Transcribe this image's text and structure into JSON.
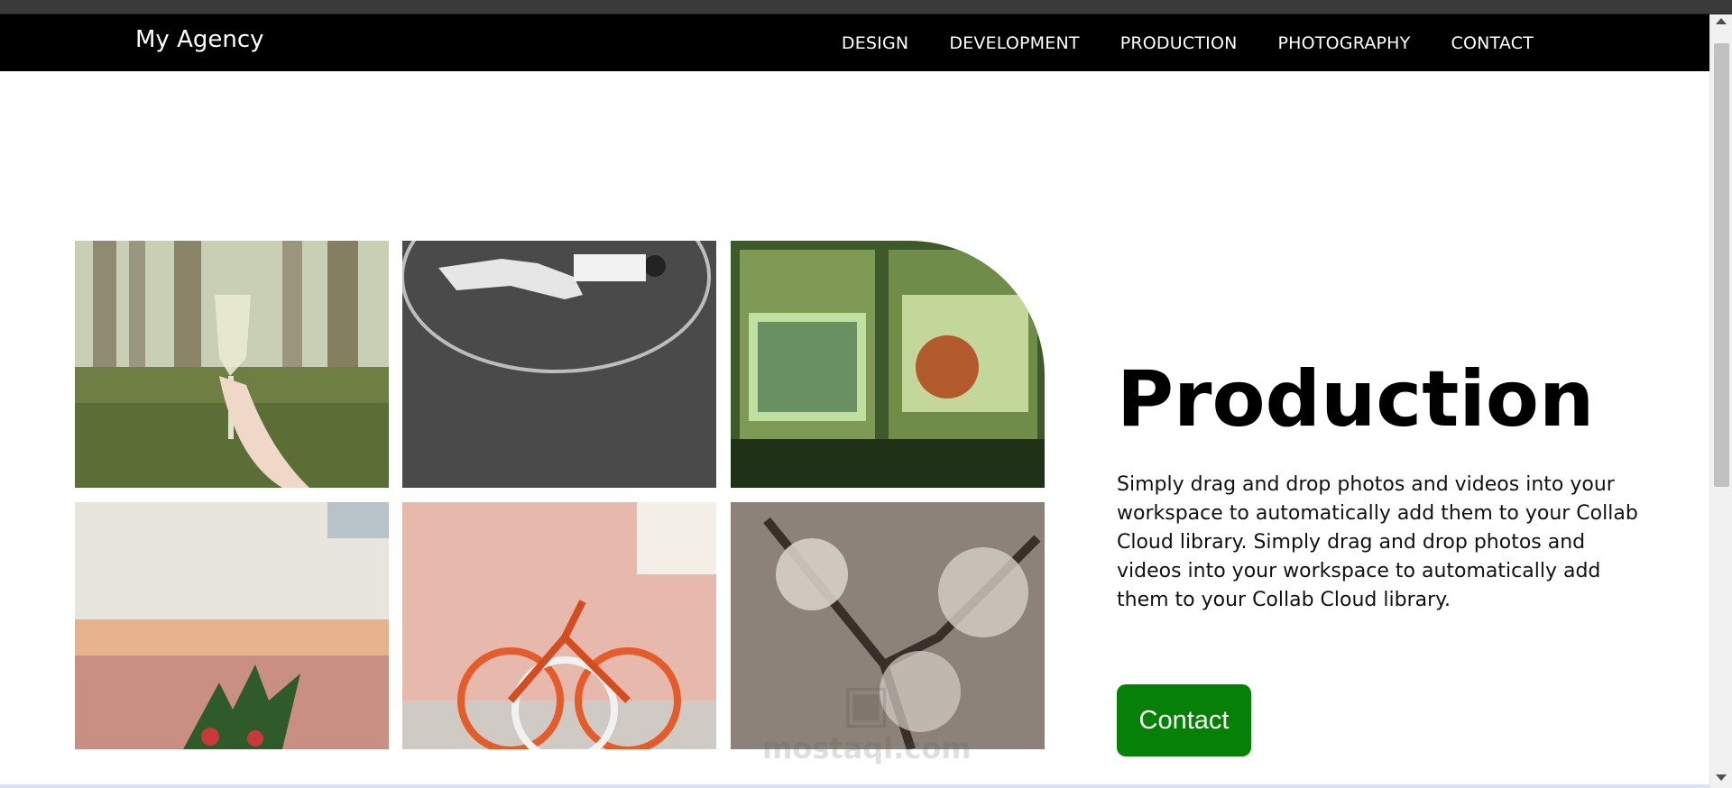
{
  "header": {
    "brand": "My Agency",
    "nav": [
      {
        "label": "DESIGN"
      },
      {
        "label": "DEVELOPMENT"
      },
      {
        "label": "PRODUCTION"
      },
      {
        "label": "PHOTOGRAPHY"
      },
      {
        "label": "CONTACT"
      }
    ]
  },
  "gallery": {
    "images": [
      {
        "subject": "hand holding a champagne glass in a forest"
      },
      {
        "subject": "person lying on asphalt next to a painted circle"
      },
      {
        "subject": "green-tinted subway car interior"
      },
      {
        "subject": "pink building corner with potted plant"
      },
      {
        "subject": "orange bicycles parked by a pink wall"
      },
      {
        "subject": "frosted pine branches"
      }
    ]
  },
  "hero": {
    "title": "Production",
    "description": "Simply drag and drop photos and videos into your workspace to automatically add them to your Collab Cloud library. Simply drag and drop photos and videos into your workspace to automatically add them to your Collab Cloud library.",
    "button_label": "Contact"
  },
  "watermark": {
    "text": "mostaql.com"
  },
  "colors": {
    "navbar": "#000000",
    "button": "#078007",
    "text": "#000000"
  }
}
